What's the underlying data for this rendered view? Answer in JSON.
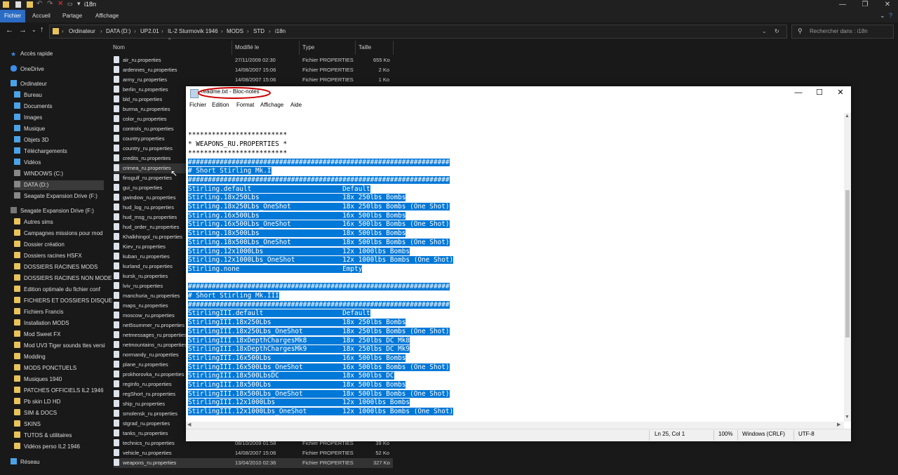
{
  "explorer": {
    "title": "i18n",
    "ribbon_tabs": [
      "Fichier",
      "Accueil",
      "Partage",
      "Affichage"
    ],
    "breadcrumb": [
      "Ordinateur",
      "DATA (D:)",
      "UP2.01",
      "IL-2 Sturmovik 1946",
      "MODS",
      "STD",
      "i18n"
    ],
    "search_placeholder": "Rechercher dans : i18n",
    "columns": [
      "Nom",
      "Modifié le",
      "Type",
      "Taille"
    ],
    "nav": {
      "quick_access": "Accès rapide",
      "onedrive": "OneDrive",
      "computer": "Ordinateur",
      "computer_items": [
        "Bureau",
        "Documents",
        "Images",
        "Musique",
        "Objets 3D",
        "Téléchargements",
        "Vidéos",
        "WINDOWS (C:)",
        "DATA (D:)",
        "Seagate Expansion Drive (F:)"
      ],
      "seagate": "Seagate Expansion Drive (F:)",
      "seagate_items": [
        "Autres sims",
        "Campagnes missions pour mod",
        "Dossier création",
        "Dossiers racines HSFX",
        "DOSSIERS RACINES MODS",
        "DOSSIERS RACINES NON MODE",
        "Edition optimale du fichier conf",
        "FICHIERS ET DOSSIERS DISQUE",
        "Fichiers Francis",
        "Installation MODS",
        "Mod Sweet FX",
        "Mod UV3 Tiger sounds ttes versi",
        "Modding",
        "MODS PONCTUELS",
        "Musiques 1940",
        "PATCHES OFFICIELS IL2 1946",
        "Pb skin LD HD",
        "SIM & DOCS",
        "SKINS",
        "TUTOS & utilitaires",
        "Vidéos perso IL2 1946"
      ],
      "network": "Réseau"
    },
    "files": [
      {
        "name": "air_ru.properties",
        "date": "27/11/2009 02:30",
        "type": "Fichier PROPERTIES",
        "size": "655 Ko"
      },
      {
        "name": "ardennes_ru.properties",
        "date": "14/08/2007 15:06",
        "type": "Fichier PROPERTIES",
        "size": "2 Ko"
      },
      {
        "name": "army_ru.properties",
        "date": "14/08/2007 15:06",
        "type": "Fichier PROPERTIES",
        "size": "1 Ko"
      },
      {
        "name": "berlin_ru.properties"
      },
      {
        "name": "bld_ru.properties"
      },
      {
        "name": "burma_ru.properties"
      },
      {
        "name": "color_ru.properties"
      },
      {
        "name": "controls_ru.properties"
      },
      {
        "name": "country.properties"
      },
      {
        "name": "country_ru.properties"
      },
      {
        "name": "credits_ru.properties"
      },
      {
        "name": "crimea_ru.properties"
      },
      {
        "name": "finsgulf_ru.properties"
      },
      {
        "name": "gui_ru.properties"
      },
      {
        "name": "gwindow_ru.properties"
      },
      {
        "name": "hud_log_ru.properties"
      },
      {
        "name": "hud_msg_ru.properties"
      },
      {
        "name": "hud_order_ru.properties"
      },
      {
        "name": "Khalkhingol_ru.properties"
      },
      {
        "name": "Kiev_ru.properties"
      },
      {
        "name": "kuban_ru.properties"
      },
      {
        "name": "kurland_ru.properties"
      },
      {
        "name": "kursk_ru.properties"
      },
      {
        "name": "lviv_ru.properties"
      },
      {
        "name": "manchuria_ru.properties"
      },
      {
        "name": "maps_ru.properties"
      },
      {
        "name": "moscow_ru.properties"
      },
      {
        "name": "net5summer_ru.properties"
      },
      {
        "name": "netmessages_ru.properties"
      },
      {
        "name": "netmountains_ru.properties"
      },
      {
        "name": "normandy_ru.properties"
      },
      {
        "name": "plane_ru.properties"
      },
      {
        "name": "prokhorovka_ru.properties"
      },
      {
        "name": "regInfo_ru.properties"
      },
      {
        "name": "regShort_ru.properties"
      },
      {
        "name": "ship_ru.properties"
      },
      {
        "name": "smolensk_ru.properties"
      },
      {
        "name": "stgrad_ru.properties"
      },
      {
        "name": "tanks_ru.properties"
      },
      {
        "name": "technics_ru.properties",
        "date": "08/10/2009 01:58",
        "type": "Fichier PROPERTIES",
        "size": "39 Ko"
      },
      {
        "name": "vehicle_ru.properties",
        "date": "14/08/2007 15:06",
        "type": "Fichier PROPERTIES",
        "size": "52 Ko"
      },
      {
        "name": "weapons_ru.properties",
        "date": "13/04/2010 02:36",
        "type": "Fichier PROPERTIES",
        "size": "327 Ko"
      }
    ]
  },
  "notepad": {
    "title": "readme.txt - Bloc-notes",
    "menu": [
      "Fichier",
      "Edition",
      "Format",
      "Affichage",
      "Aide"
    ],
    "lines": [
      {
        "text": "",
        "hl": false
      },
      {
        "text": "",
        "hl": false
      },
      {
        "text": "*************************",
        "hl": false
      },
      {
        "text": "* WEAPONS_RU.PROPERTIES *",
        "hl": false
      },
      {
        "text": "*************************",
        "hl": false
      },
      {
        "text": "##################################################################",
        "hl": true
      },
      {
        "text": "# Short Stirling Mk.I",
        "hl": true
      },
      {
        "text": "##################################################################",
        "hl": true
      },
      {
        "text": "Stirling.default                       Default",
        "hl": true
      },
      {
        "text": "Stirling.18x250Lbs                     18x 250lbs Bombs",
        "hl": true
      },
      {
        "text": "Stirling.18x250Lbs_OneShot             18x 250lbs Bombs (One Shot)",
        "hl": true
      },
      {
        "text": "Stirling.16x500Lbs                     16x 500lbs Bombs",
        "hl": true
      },
      {
        "text": "Stirling.16x500Lbs_OneShot             16x 500lbs Bombs (One Shot)",
        "hl": true
      },
      {
        "text": "Stirling.18x500Lbs                     18x 500lbs Bombs",
        "hl": true
      },
      {
        "text": "Stirling.18x500Lbs_OneShot             18x 500lbs Bombs (One Shot)",
        "hl": true
      },
      {
        "text": "Stirling.12x1000Lbs                    12x 1000lbs Bombs",
        "hl": true
      },
      {
        "text": "Stirling.12x1000Lbs_OneShot            12x 1000lbs Bombs (One Shot)",
        "hl": true
      },
      {
        "text": "Stirling.none                          Empty",
        "hl": true
      },
      {
        "text": "",
        "hl": false
      },
      {
        "text": "##################################################################",
        "hl": true
      },
      {
        "text": "# Short Stirling Mk.III",
        "hl": true
      },
      {
        "text": "##################################################################",
        "hl": true
      },
      {
        "text": "StirlingIII.default                    Default",
        "hl": true
      },
      {
        "text": "StirlingIII.18x250Lbs                  18x 250lbs Bombs",
        "hl": true
      },
      {
        "text": "StirlingIII.18x250Lbs_OneShot          18x 250lbs Bombs (One Shot)",
        "hl": true
      },
      {
        "text": "StirlingIII.18xDepthChargesMk8         18x 250lbs DC Mk8",
        "hl": true
      },
      {
        "text": "StirlingIII.18xDepthChargesMk9         18x 250lbs DC Mk9",
        "hl": true
      },
      {
        "text": "StirlingIII.16x500Lbs                  16x 500lbs Bombs",
        "hl": true
      },
      {
        "text": "StirlingIII.16x500Lbs_OneShot          16x 500lbs Bombs (One Shot)",
        "hl": true
      },
      {
        "text": "StirlingIII.18x500LbsDC                18x 500lbs DC",
        "hl": true
      },
      {
        "text": "StirlingIII.18x500Lbs                  18x 500lbs Bombs",
        "hl": true
      },
      {
        "text": "StirlingIII.18x500Lbs_OneShot          18x 500lbs Bombs (One Shot)",
        "hl": true
      },
      {
        "text": "StirlingIII.12x1000Lbs                 12x 1000lbs Bombs",
        "hl": true
      },
      {
        "text": "StirlingIII.12x1000Lbs_OneShot         12x 1000lbs Bombs (One Shot)",
        "hl": true
      }
    ],
    "status": {
      "position": "Ln 25, Col 1",
      "zoom": "100%",
      "eol": "Windows (CRLF)",
      "encoding": "UTF-8"
    },
    "annotation_color": "#cc0000",
    "selection_color": "#0078d7"
  }
}
